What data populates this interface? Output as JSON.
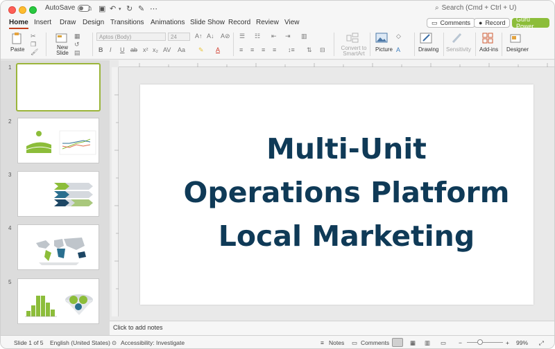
{
  "titlebar": {
    "autosave_label": "AutoSave",
    "search_placeholder": "Search (Cmd + Ctrl + U)"
  },
  "tabs": [
    "Home",
    "Insert",
    "Draw",
    "Design",
    "Transitions",
    "Animations",
    "Slide Show",
    "Record",
    "Review",
    "View"
  ],
  "actions": {
    "comments": "Comments",
    "record": "Record",
    "guru": "Guru Power"
  },
  "ribbon": {
    "paste": "Paste",
    "new_slide": "New Slide",
    "font_name": "Aptos (Body)",
    "font_size": "24",
    "convert_smartart": "Convert to SmartArt",
    "picture": "Picture",
    "drawing": "Drawing",
    "sensitivity": "Sensitivity",
    "addins": "Add-ins",
    "designer": "Designer"
  },
  "thumbnails": [
    {
      "num": "1"
    },
    {
      "num": "2"
    },
    {
      "num": "3"
    },
    {
      "num": "4"
    },
    {
      "num": "5"
    }
  ],
  "slide": {
    "title_lines": [
      "Multi-Unit",
      "Operations Platform",
      "Local Marketing"
    ]
  },
  "notes_placeholder": "Click to add notes",
  "status": {
    "slide_of": "Slide 1 of 5",
    "language": "English (United States)",
    "accessibility": "Accessibility: Investigate",
    "notes": "Notes",
    "comments": "Comments",
    "zoom": "99%"
  },
  "colors": {
    "accent_tab": "#c43e1c",
    "title": "#0f3a57",
    "thumb_green": "#8cbd3a",
    "guru": "#8cbd3a"
  }
}
